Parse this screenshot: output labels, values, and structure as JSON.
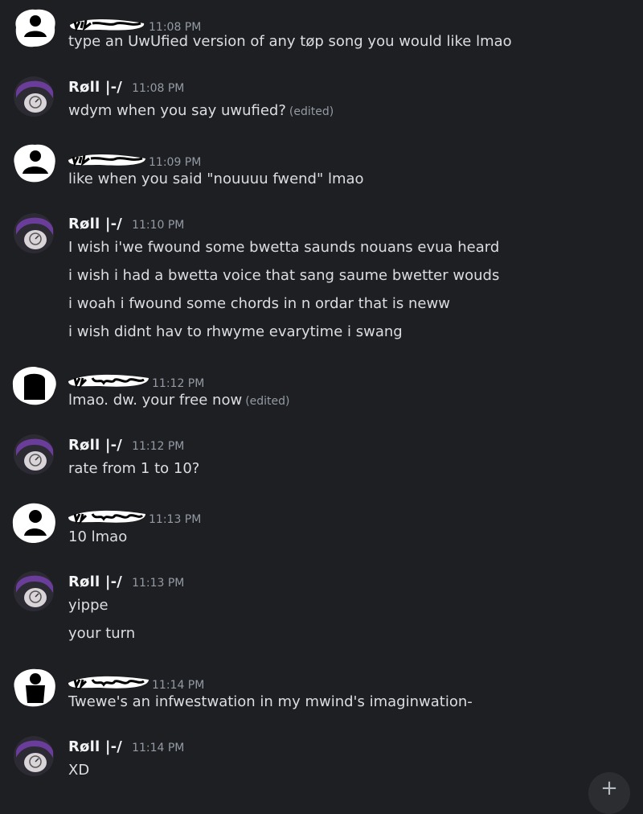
{
  "users": {
    "a_name": "ur mom",
    "b_name": "Røll |-/"
  },
  "messages": [
    {
      "time": "11:08 PM",
      "lines": [
        "type an UwUfied version of any tøp song you would like lmao"
      ]
    },
    {
      "time": "11:08 PM",
      "lines": [
        "wdym when you say uwufied?"
      ],
      "edited": "(edited)"
    },
    {
      "time": "11:09 PM",
      "lines": [
        "like when you said \"nouuuu fwend\" lmao"
      ]
    },
    {
      "time": "11:10 PM",
      "lines": [
        "I wish i'we fwound some bwetta saunds nouans evua heard",
        "i wish i had a bwetta voice that sang saume bwetter wouds",
        "i woah i fwound some chords in n ordar that is neww",
        "i wish didnt hav to rhwyme evarytime i swang"
      ]
    },
    {
      "time": "11:12 PM",
      "lines": [
        "lmao. dw. your free now"
      ],
      "edited": "(edited)"
    },
    {
      "time": "11:12 PM",
      "lines": [
        "rate from 1 to 10?"
      ]
    },
    {
      "time": "11:13 PM",
      "lines": [
        "10 lmao"
      ]
    },
    {
      "time": "11:13 PM",
      "lines": [
        "yippe",
        "your turn"
      ]
    },
    {
      "time": "11:14 PM",
      "lines": [
        "Twewe's an infwestwation in my mwind's imaginwation-"
      ]
    },
    {
      "time": "11:14 PM",
      "lines": [
        "XD"
      ]
    }
  ],
  "fab": {
    "label": "+"
  },
  "icons": {
    "scribble_avatar": "scribbled-out-avatar-icon",
    "pfp_avatar": "purple-hair-avatar-icon",
    "add": "plus-icon"
  }
}
